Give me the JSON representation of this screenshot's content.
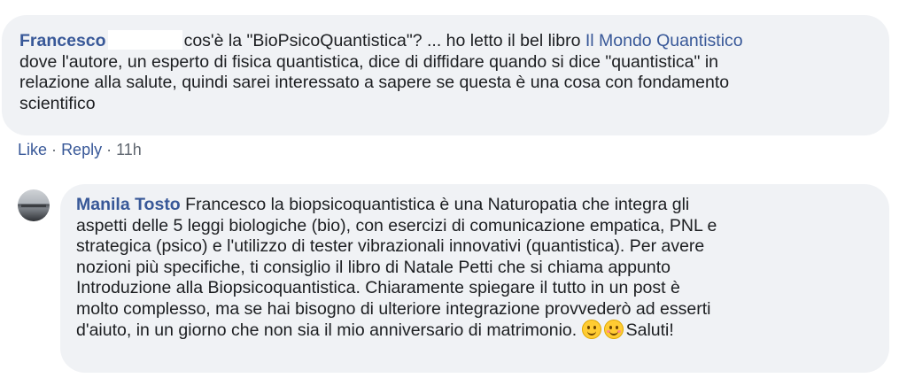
{
  "comment1": {
    "author": "Francesco",
    "text_before_link": "cos'è la \"BioPsicoQuantistica\"? ... ho letto il bel libro ",
    "link_text": "Il Mondo Quantistico",
    "text_after_link": "\ndove l'autore, un esperto di fisica quantistica, dice di diffidare quando si dice \"quantistica\" in\nrelazione alla salute, quindi sarei interessato a sapere se questa è una cosa con fondamento\nscientifico",
    "actions": {
      "like": "Like",
      "separator": "·",
      "reply": "Reply",
      "time": "11h"
    }
  },
  "comment2": {
    "author": "Manila Tosto",
    "text": " Francesco la biopsicoquantistica è una Naturopatia che integra gli\naspetti delle 5 leggi biologiche (bio), con esercizi di comunicazione empatica, PNL e\nstrategica (psico) e l'utilizzo di tester vibrazionali innovativi (quantistica). Per avere\nnozioni più specifiche, ti consiglio il libro di Natale Petti che si chiama appunto\nIntroduzione alla Biopsicoquantistica. Chiaramente spiegare il tutto in un post è\nmolto complesso, ma se hai bisogno di ulteriore integrazione provvederò ad esserti\nd'aiuto, in un giorno che non sia il mio anniversario di matrimonio. ",
    "closing": "Saluti!",
    "emojis": [
      "wink-face",
      "smiling-face-blush"
    ]
  },
  "colors": {
    "bubble_bg": "#f0f2f5",
    "link_blue": "#385898",
    "meta_gray": "#606770"
  }
}
